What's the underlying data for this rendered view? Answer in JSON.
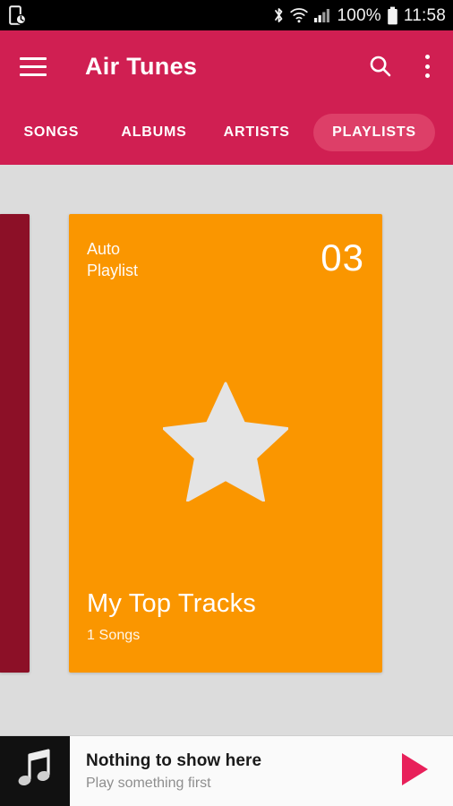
{
  "status_bar": {
    "left_icon": "phone-clock-icon",
    "icons": [
      "bluetooth-icon",
      "wifi-icon",
      "cellular-signal-icon"
    ],
    "battery_percent": "100%",
    "battery_icon": "battery-full-icon",
    "time": "11:58"
  },
  "appbar": {
    "menu_icon": "hamburger-menu-icon",
    "title": "Air Tunes",
    "search_icon": "search-icon",
    "overflow_icon": "overflow-menu-icon"
  },
  "tabs": [
    {
      "label": "SONGS",
      "active": false
    },
    {
      "label": "ALBUMS",
      "active": false
    },
    {
      "label": "ARTISTS",
      "active": false
    },
    {
      "label": "PLAYLISTS",
      "active": true
    }
  ],
  "playlists": [
    {
      "kind": "",
      "count": "",
      "name": "",
      "songs": "",
      "color": "#8c1027",
      "partial": true
    },
    {
      "kind_line1": "Auto",
      "kind_line2": "Playlist",
      "count": "03",
      "name": "My Top Tracks",
      "songs": "1 Songs",
      "color": "#fa9600",
      "art_icon": "star-icon",
      "partial": false
    }
  ],
  "now_playing": {
    "thumb_icon": "music-note-icon",
    "title": "Nothing to show here",
    "subtitle": "Play something first",
    "play_icon": "play-icon"
  },
  "colors": {
    "accent": "#d01f52",
    "tab_active": "#dd3f68",
    "card_orange": "#fa9600",
    "card_dark_red": "#8c1027",
    "background": "#dcdcdc",
    "star": "#e4e4e4",
    "play_button": "#e8205a"
  }
}
